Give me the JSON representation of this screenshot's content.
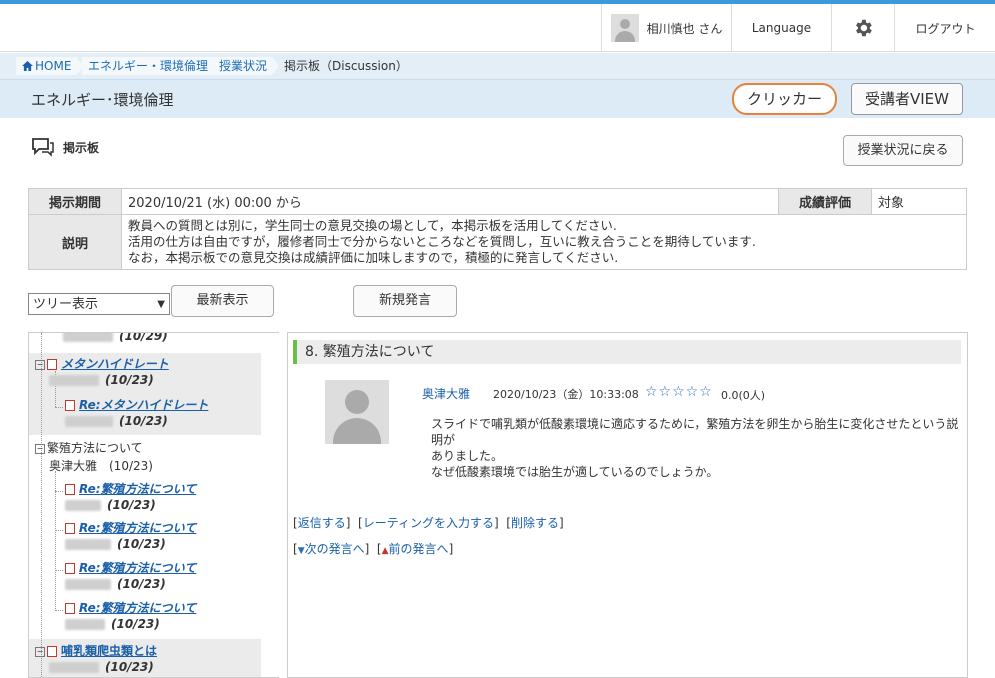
{
  "header": {
    "user_name": "相川慎也 さん",
    "language": "Language",
    "logout": "ログアウト"
  },
  "breadcrumb": [
    "HOME",
    "エネルギー・環境倫理",
    "授業状況",
    "掲示板（Discussion）"
  ],
  "course": {
    "title": "エネルギー･環境倫理",
    "clicker": "クリッカー",
    "student_view": "受講者VIEW"
  },
  "section": {
    "title": "掲示板",
    "back_button": "授業状況に戻る"
  },
  "info": {
    "period_label": "掲示期間",
    "period_value": "2020/10/21 (水) 00:00 から",
    "grade_label": "成績評価",
    "grade_value": "対象",
    "desc_label": "説明",
    "desc_lines": [
      "教員への質問とは別に，学生同士の意見交換の場として，本掲示板を活用してください.",
      "活用の仕方は自由ですが，履修者同士で分からないところなどを質問し，互いに教え合うことを期待しています.",
      "なお，本掲示板での意見交換は成績評価に加味しますので，積極的に発言してください."
    ]
  },
  "controls": {
    "view_select": "ツリー表示",
    "latest": "最新表示",
    "new_post": "新規発言"
  },
  "tree": [
    {
      "title": "",
      "date": "(10/29)"
    },
    {
      "title": "メタンハイドレート",
      "date": "(10/23)"
    },
    {
      "title": "Re:メタンハイドレート",
      "date": "(10/23)"
    },
    {
      "title": "繁殖方法について",
      "date": "奥津大雅　(10/23)"
    },
    {
      "title": "Re:繁殖方法について",
      "date": "(10/23)"
    },
    {
      "title": "Re:繁殖方法について",
      "date": "(10/23)"
    },
    {
      "title": "Re:繁殖方法について",
      "date": "(10/23)"
    },
    {
      "title": "Re:繁殖方法について",
      "date": "(10/23)"
    },
    {
      "title": "哺乳類爬虫類とは",
      "date": "(10/23)"
    }
  ],
  "post": {
    "heading": "8. 繁殖方法について",
    "author": "奥津大雅",
    "datetime": "2020/10/23（金）10:33:08",
    "stars": "☆☆☆☆☆",
    "rating": "0.0(0人)",
    "body": [
      "スライドで哺乳類が低酸素環境に適応するために，繁殖方法を卵生から胎生に変化させたという説明が",
      "ありました。",
      "なぜ低酸素環境では胎生が適しているのでしょうか。"
    ],
    "reply": "返信する",
    "rating_input": "レーティングを入力する",
    "delete": "削除する",
    "next": "次の発言へ",
    "prev": "前の発言へ"
  }
}
